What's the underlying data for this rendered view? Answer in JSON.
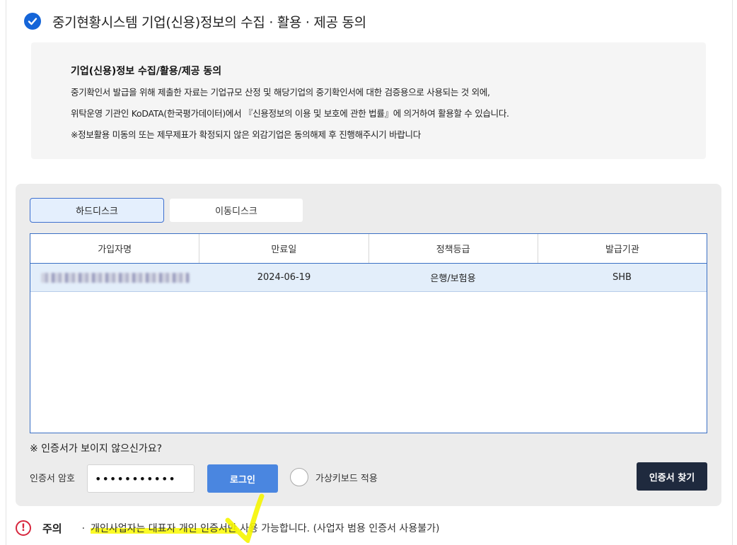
{
  "consent": {
    "title": "중기현황시스템 기업(신용)정보의 수집 · 활용 · 제공 동의",
    "box_heading": "기업(신용)정보 수집/활용/제공 동의",
    "line1": "중기확인서 발급을 위해 제출한 자료는 기업규모 산정 및 해당기업의 중기확인서에 대한 검증용으로 사용되는 것 외에,",
    "line2": "위탁운영 기관인 KoDATA(한국평가데이터)에서 『신용정보의 이용 및 보호에 관한 법률』에 의거하여 활용할 수 있습니다.",
    "line3": "※정보활용 미동의 또는 제무제표가 확정되지 않은 외감기업은 동의해제 후 진행해주시기 바랍니다"
  },
  "tabs": {
    "hard_disk": "하드디스크",
    "removable_disk": "이동디스크"
  },
  "table": {
    "columns": [
      "가입자명",
      "만료일",
      "정책등급",
      "발급기관"
    ],
    "rows": [
      {
        "subscriber": "",
        "expiry": "2024-06-19",
        "policy": "은행/보험용",
        "issuer": "SHB"
      }
    ]
  },
  "no_cert_text": "※ 인증서가 보이지 않으신가요?",
  "password": {
    "label": "인증서 암호",
    "value": "•••••••••••"
  },
  "buttons": {
    "login": "로그인",
    "find_cert": "인증서 찾기"
  },
  "virtual_keyboard": "가상키보드 적용",
  "notice": {
    "icon_text": "!",
    "label": "주의",
    "bullet": "·",
    "highlight": "개인사업자는 대표자 개인 인증서만",
    "rest": " 사용 가능합니다. (사업자 범용 인증서 사용불가)"
  },
  "colors": {
    "accent": "#1565d8",
    "login_button": "#4a86e0",
    "find_button": "#1f2a3e",
    "warning": "#d7263d",
    "highlight": "#fafa00"
  }
}
